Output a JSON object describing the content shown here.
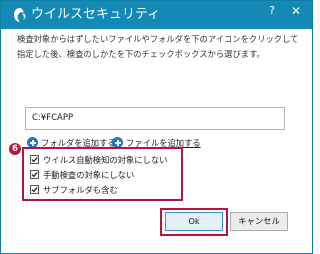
{
  "window": {
    "title": "ウイルスセキュリティ",
    "help_label": "?",
    "close_label": "✕"
  },
  "description": "検査対象からはずしたいファイルやフォルダを下のアイコンをクリックして指定した後、検査のしかたを下のチェックボックスから選びます。",
  "folder_list": {
    "items": [
      "C:¥FCAPP"
    ]
  },
  "add_links": {
    "folder_label": "フォルダを追加する",
    "file_label": "ファイルを追加する"
  },
  "step_badge": "6",
  "options": [
    {
      "label": "ウイルス自動検知の対象にしない",
      "checked": true
    },
    {
      "label": "手動検査の対象にしない",
      "checked": true
    },
    {
      "label": "サブフォルダも含む",
      "checked": true
    }
  ],
  "buttons": {
    "ok_label": "Ok",
    "cancel_label": "キャンセル"
  },
  "colors": {
    "titlebar": "#1489b6",
    "highlight": "#b4163f",
    "link_icon": "#1d78c1"
  },
  "icons": {
    "app": "shield-swirl-icon",
    "add": "plus-circle-icon",
    "check": "check-icon"
  }
}
